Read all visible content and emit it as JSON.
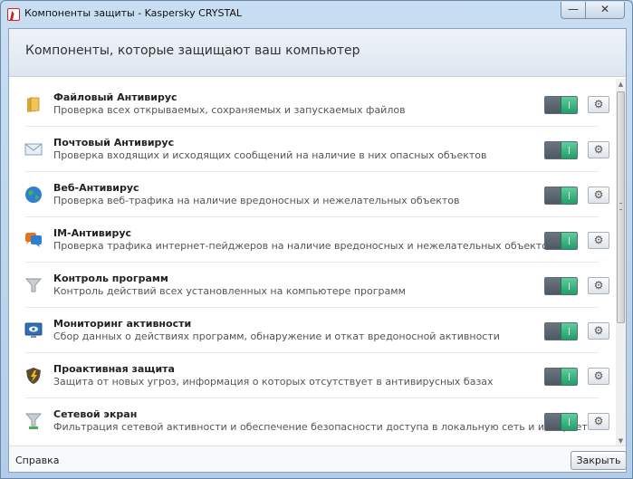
{
  "window": {
    "title": "Компоненты защиты - Kaspersky CRYSTAL",
    "minimize_symbol": "—",
    "close_symbol": "✕"
  },
  "header": {
    "title": "Компоненты, которые защищают ваш компьютер"
  },
  "components": [
    {
      "name": "Файловый Антивирус",
      "description": "Проверка всех открываемых, сохраняемых и запускаемых файлов",
      "icon": "folder-icon",
      "enabled": true
    },
    {
      "name": "Почтовый Антивирус",
      "description": "Проверка входящих и исходящих сообщений на наличие в них опасных объектов",
      "icon": "envelope-icon",
      "enabled": true
    },
    {
      "name": "Веб-Антивирус",
      "description": "Проверка веб-трафика на наличие вредоносных и нежелательных объектов",
      "icon": "globe-icon",
      "enabled": true
    },
    {
      "name": "IM-Антивирус",
      "description": "Проверка трафика интернет-пейджеров на наличие вредоносных и нежелательных объектов",
      "icon": "chat-bubble-icon",
      "enabled": true
    },
    {
      "name": "Контроль программ",
      "description": "Контроль действий всех установленных на компьютере программ",
      "icon": "funnel-icon",
      "enabled": true
    },
    {
      "name": "Мониторинг активности",
      "description": "Сбор данных о действиях программ, обнаружение и откат вредоносной активности",
      "icon": "monitor-eye-icon",
      "enabled": true
    },
    {
      "name": "Проактивная защита",
      "description": "Защита от новых угроз, информация о которых отсутствует в антивирусных базах",
      "icon": "shield-lightning-icon",
      "enabled": true
    },
    {
      "name": "Сетевой экран",
      "description": "Фильтрация сетевой активности и обеспечение безопасности доступа в локальную сеть и интернет",
      "icon": "firewall-funnel-icon",
      "enabled": true
    }
  ],
  "gear_symbol": "⚙",
  "scrollbar": {
    "up_symbol": "▲",
    "down_symbol": "▼"
  },
  "footer": {
    "help_label": "Справка",
    "close_label": "Закрыть"
  },
  "colors": {
    "toggle_on": "#1e9f68",
    "title_bar": "#c9def3"
  }
}
